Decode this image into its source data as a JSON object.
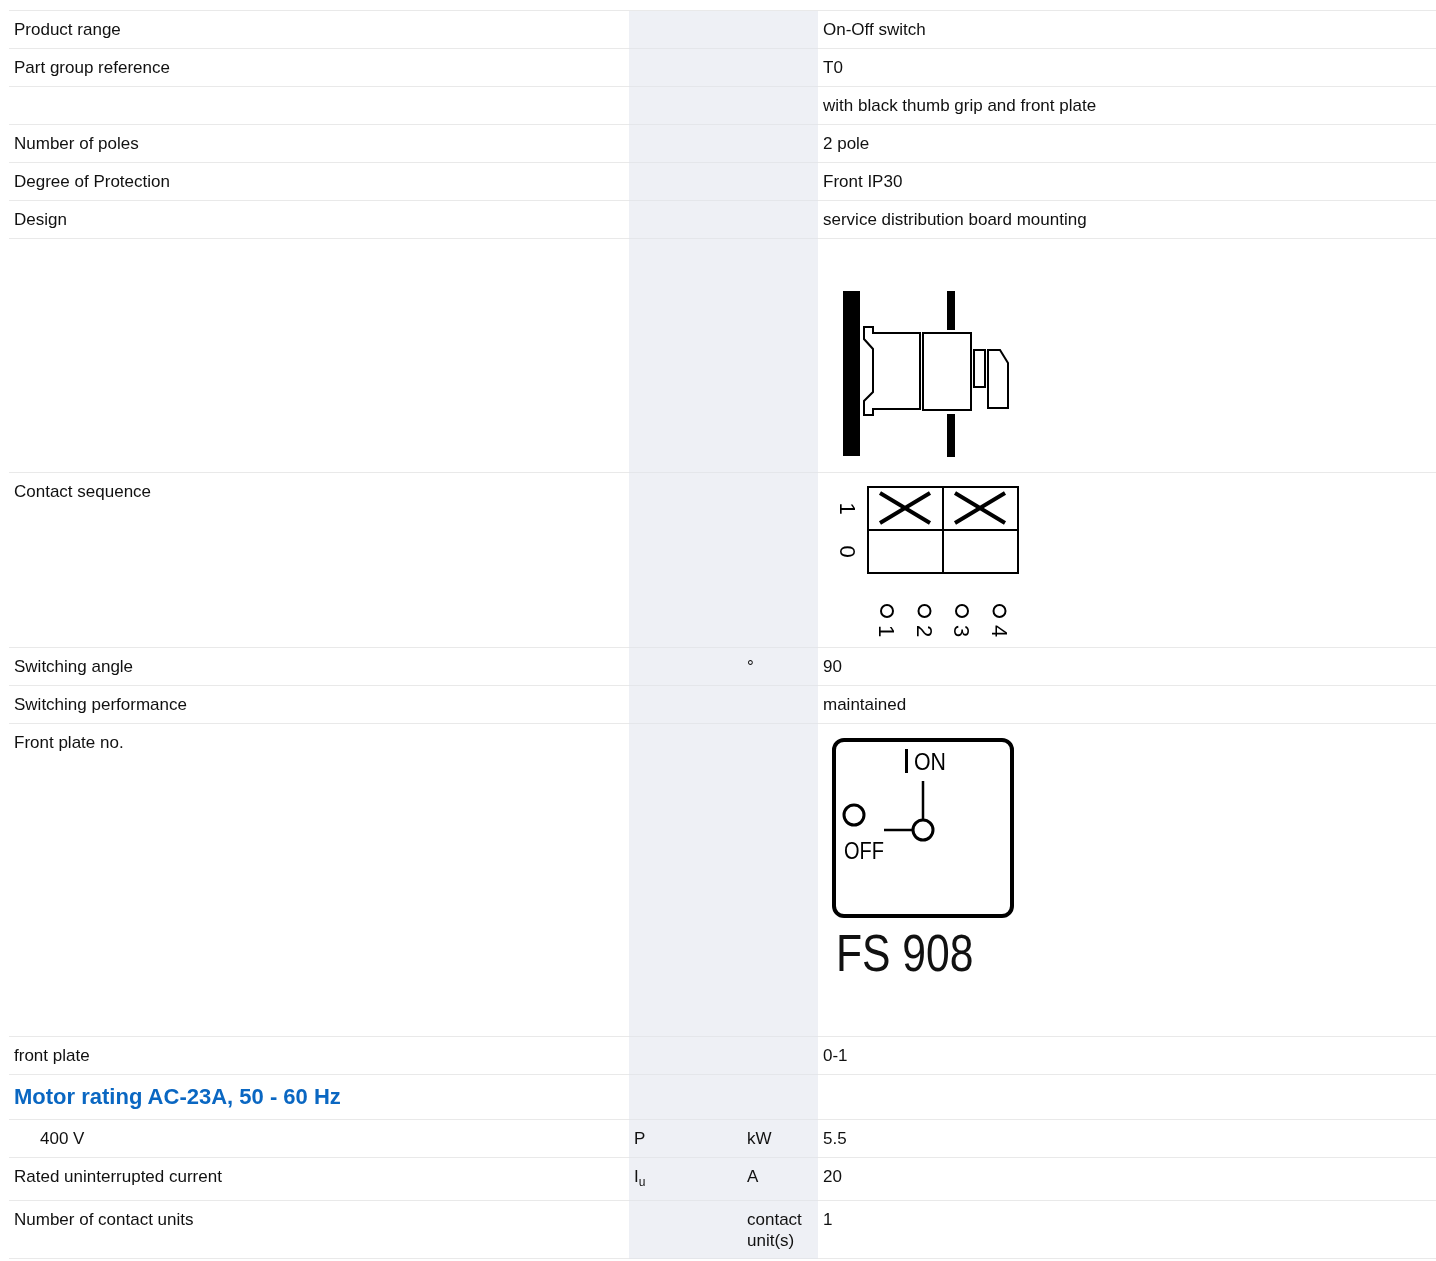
{
  "rows": [
    {
      "kind": "text",
      "label": "Product range",
      "symbol": "",
      "unit": "",
      "value": "On-Off switch"
    },
    {
      "kind": "text",
      "label": "Part group reference",
      "symbol": "",
      "unit": "",
      "value": "T0"
    },
    {
      "kind": "text",
      "label": "",
      "symbol": "",
      "unit": "",
      "value": "with black thumb grip and front plate"
    },
    {
      "kind": "text",
      "label": "Number of poles",
      "symbol": "",
      "unit": "",
      "value": "2 pole"
    },
    {
      "kind": "text",
      "label": "Degree of Protection",
      "symbol": "",
      "unit": "",
      "value": "Front IP30"
    },
    {
      "kind": "text",
      "label": "Design",
      "symbol": "",
      "unit": "",
      "value": "service distribution board mounting"
    },
    {
      "kind": "figure",
      "label": "",
      "figure": {
        "kind": "side-view"
      }
    },
    {
      "kind": "figure",
      "label": "Contact sequence",
      "figure": {
        "kind": "contact-sequence",
        "positions": [
          {
            "label": "1",
            "contacts": [
              {
                "closed": true
              },
              {
                "closed": true
              }
            ]
          },
          {
            "label": "0",
            "contacts": [
              {
                "closed": false
              },
              {
                "closed": false
              }
            ]
          }
        ],
        "terminals": [
          "1",
          "2",
          "3",
          "4"
        ]
      }
    },
    {
      "kind": "text",
      "label": "Switching angle",
      "symbol": "",
      "unit": "°",
      "value": "90"
    },
    {
      "kind": "text",
      "label": "Switching performance",
      "symbol": "",
      "unit": "",
      "value": "maintained"
    },
    {
      "kind": "figure",
      "label": "Front plate no.",
      "figure": {
        "kind": "front-plate",
        "on_label": "ON",
        "off_label": "OFF",
        "code": "FS 908"
      }
    },
    {
      "kind": "text",
      "label": "front plate",
      "symbol": "",
      "unit": "",
      "value": "0-1"
    },
    {
      "kind": "heading",
      "label": "Motor rating AC-23A, 50 - 60 Hz"
    },
    {
      "kind": "subtext",
      "label": "400 V",
      "symbol": "P",
      "unit": "kW",
      "value": "5.5"
    },
    {
      "kind": "text",
      "label": "Rated uninterrupted current",
      "symbol": "I$_{u}$",
      "unit": "A",
      "value": "20"
    },
    {
      "kind": "text",
      "label": "Number of contact units",
      "symbol": "",
      "unit": "contact unit(s)",
      "value": "1"
    }
  ]
}
